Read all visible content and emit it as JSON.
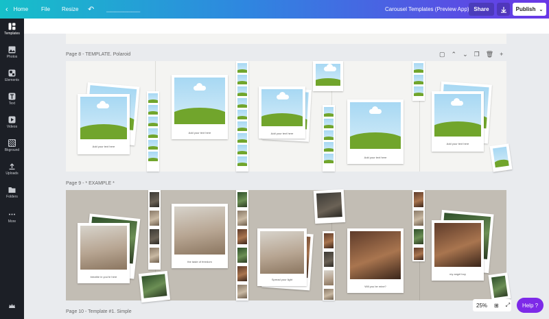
{
  "topbar": {
    "home": "Home",
    "file": "File",
    "resize": "Resize",
    "title": "Carousel Templates (Preview App)",
    "share": "Share",
    "publish": "Publish"
  },
  "rail": [
    {
      "label": "Templates",
      "icon": "templates-icon"
    },
    {
      "label": "Photos",
      "icon": "photos-icon"
    },
    {
      "label": "Elements",
      "icon": "elements-icon"
    },
    {
      "label": "Text",
      "icon": "text-icon"
    },
    {
      "label": "Videos",
      "icon": "videos-icon"
    },
    {
      "label": "Bkground",
      "icon": "background-icon"
    },
    {
      "label": "Uploads",
      "icon": "uploads-icon"
    },
    {
      "label": "Folders",
      "icon": "folders-icon"
    },
    {
      "label": "More",
      "icon": "more-icon"
    }
  ],
  "pages": {
    "page8_label": "Page 8 - TEMPLATE. Polaroid",
    "page9_label": "Page 9 - * EXAMPLE *",
    "page10_label": "Page 10 - Template #1. Simple"
  },
  "captions": {
    "template": "Add your text here",
    "ex1": "breathe in you're here",
    "ex2": "the taste of freedom",
    "ex3": "Spread your light",
    "ex4": "Will you be mine?",
    "ex5": "my angel boy"
  },
  "zoom": {
    "value": "25%"
  },
  "help": {
    "label": "Help ?"
  }
}
